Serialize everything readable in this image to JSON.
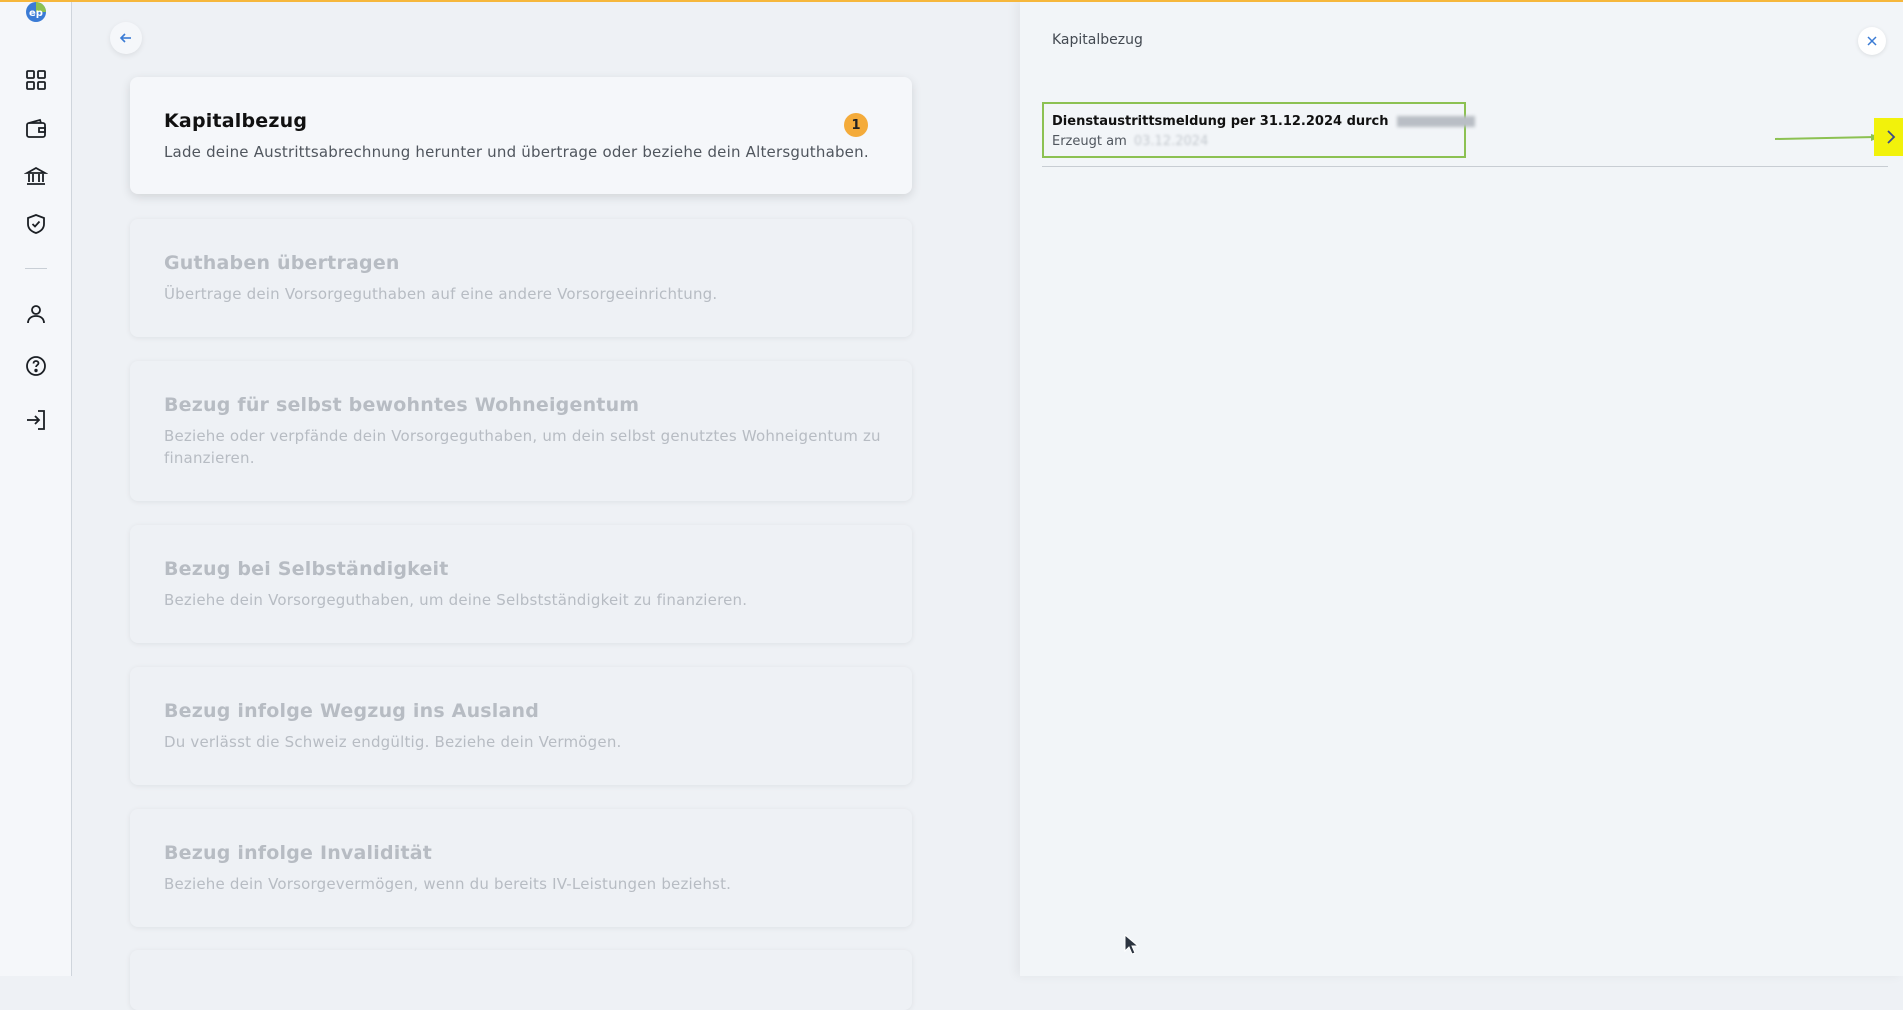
{
  "sidebar": {
    "logo": "ep",
    "icons": [
      "dashboard-icon",
      "wallet-icon",
      "bank-icon",
      "shield-check-icon",
      "user-icon",
      "help-icon",
      "logout-icon"
    ]
  },
  "main": {
    "back_icon": "arrow-left-icon",
    "cards": [
      {
        "title": "Kapitalbezug",
        "desc": "Lade deine Austrittsabrechnung herunter und übertrage oder beziehe dein Altersguthaben.",
        "badge": "1",
        "active": true
      },
      {
        "title": "Guthaben übertragen",
        "desc": "Übertrage dein Vorsorgeguthaben auf eine andere Vorsorgeeinrichtung."
      },
      {
        "title": "Bezug für selbst bewohntes Wohneigentum",
        "desc": "Beziehe oder verpfände dein Vorsorgeguthaben, um dein selbst genutztes Wohneigentum zu finanzieren."
      },
      {
        "title": "Bezug bei Selbständigkeit",
        "desc": "Beziehe dein Vorsorgeguthaben, um deine Selbstständigkeit zu finanzieren."
      },
      {
        "title": "Bezug infolge Wegzug ins Ausland",
        "desc": "Du verlässt die Schweiz endgültig. Beziehe dein Vermögen."
      },
      {
        "title": "Bezug infolge Invalidität",
        "desc": "Beziehe dein Vorsorgevermögen, wenn du bereits IV-Leistungen beziehst."
      }
    ]
  },
  "panel": {
    "title": "Kapitalbezug",
    "close_icon": "close-icon",
    "document": {
      "title": "Dienstaustrittsmeldung per 31.12.2024 durch",
      "subtitle": "Erzeugt am",
      "date": "03.12.2024"
    },
    "chevron_icon": "chevron-right-icon"
  },
  "colors": {
    "accent_orange": "#f4ab3a",
    "highlight_green": "#8cc152",
    "highlight_yellow": "#f2f20b",
    "link_blue": "#3a7bd5"
  }
}
